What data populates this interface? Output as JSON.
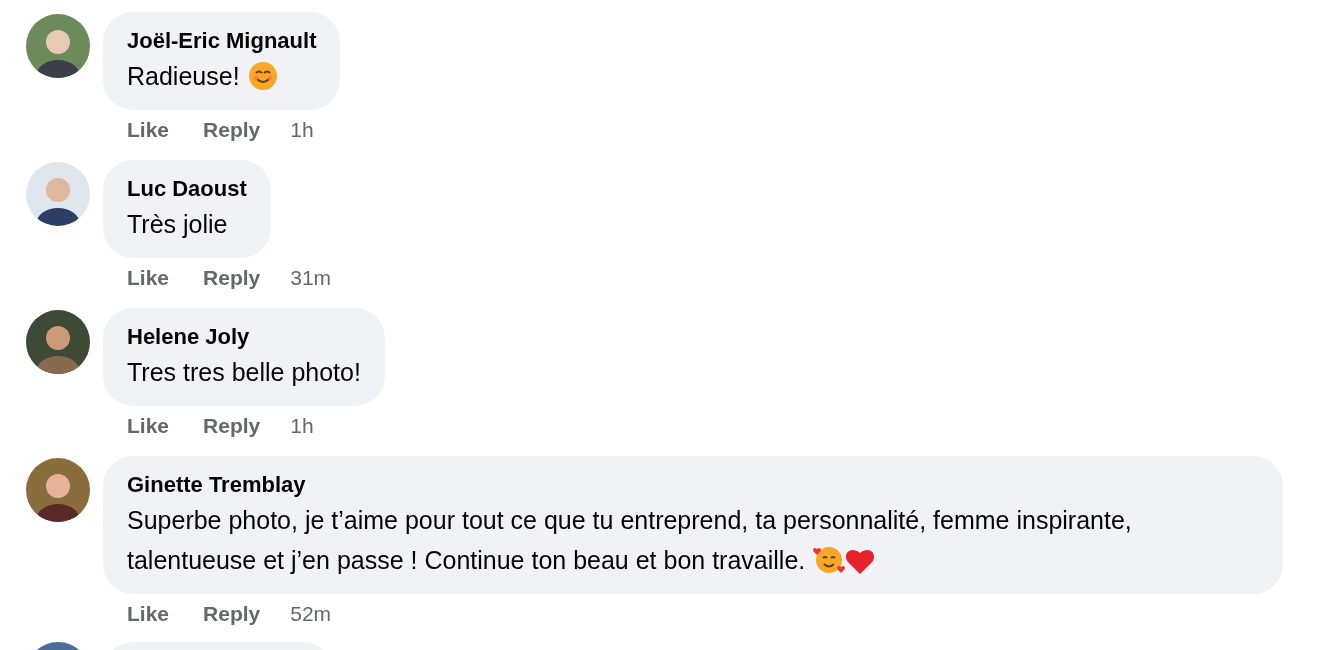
{
  "comments": [
    {
      "kind": "comment",
      "author": "Joël-Eric Mignault",
      "text": "Radieuse!",
      "trailing_icons": [
        {
          "kind": "smile"
        }
      ],
      "actions": [
        "Like",
        "Reply"
      ],
      "time": "1h"
    },
    {
      "kind": "comment",
      "author": "Luc Daoust",
      "text": "Très jolie",
      "actions": [
        "Like",
        "Reply"
      ],
      "time": "31m"
    },
    {
      "kind": "comment",
      "author": "Helene Joly",
      "text": "Tres tres belle photo!",
      "actions": [
        "Like",
        "Reply"
      ],
      "time": "1h"
    },
    {
      "kind": "comment",
      "author": "Ginette Tremblay",
      "text": "Superbe photo, je t’aime pour tout ce que tu entreprend, ta personnalité, femme inspirante, talentueuse et j’en passe ! Continue ton beau et bon travaille.",
      "trailing_icons": [
        {
          "kind": "hearts-face"
        },
        {
          "kind": "heart"
        }
      ],
      "actions": [
        "Like",
        "Reply"
      ],
      "time": "52m"
    },
    {
      "kind": "partial"
    }
  ]
}
